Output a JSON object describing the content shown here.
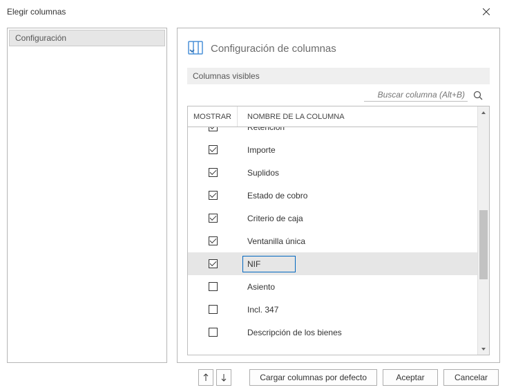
{
  "window": {
    "title": "Elegir columnas"
  },
  "sidebar": {
    "items": [
      {
        "label": "Configuración"
      }
    ]
  },
  "panel": {
    "title": "Configuración de columnas",
    "subsection": "Columnas visibles"
  },
  "search": {
    "placeholder": "Buscar columna (Alt+B)"
  },
  "table": {
    "headers": {
      "show": "MOSTRAR",
      "name": "NOMBRE DE LA COLUMNA"
    },
    "rows": [
      {
        "checked": true,
        "name": "Retención",
        "cut_top": true
      },
      {
        "checked": true,
        "name": "Importe"
      },
      {
        "checked": true,
        "name": "Suplidos"
      },
      {
        "checked": true,
        "name": "Estado de cobro"
      },
      {
        "checked": true,
        "name": "Criterio de caja"
      },
      {
        "checked": true,
        "name": "Ventanilla única"
      },
      {
        "checked": true,
        "name": "NIF",
        "selected": true
      },
      {
        "checked": false,
        "name": "Asiento"
      },
      {
        "checked": false,
        "name": "Incl. 347"
      },
      {
        "checked": false,
        "name": "Descripción de los bienes"
      }
    ]
  },
  "footer": {
    "load_defaults": "Cargar columnas por defecto",
    "ok": "Aceptar",
    "cancel": "Cancelar"
  }
}
